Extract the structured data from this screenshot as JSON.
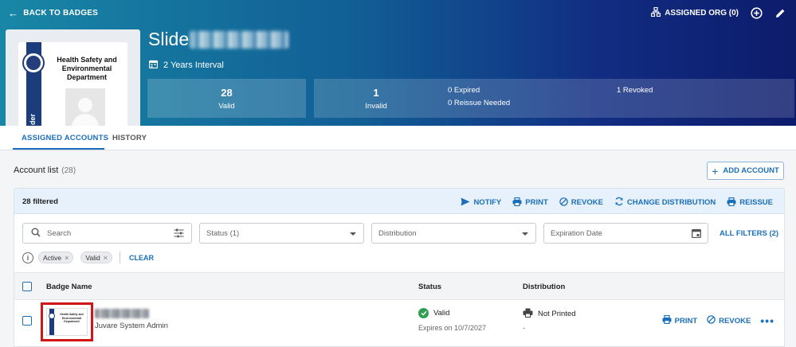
{
  "header": {
    "back_label": "BACK TO BADGES",
    "assigned_org_label": "ASSIGNED ORG (0)",
    "badge_title": "Slide",
    "interval": "2 Years Interval",
    "badge_preview": {
      "title_line": "Health Safety and Environmental Department",
      "stripe_text": "der"
    }
  },
  "stats": {
    "valid": {
      "count": "28",
      "label": "Valid"
    },
    "invalid": {
      "count": "1",
      "label": "Invalid"
    },
    "expired": "0 Expired",
    "reissue_needed": "0 Reissue Needed",
    "revoked": "1 Revoked"
  },
  "tabs": [
    {
      "label": "ASSIGNED ACCOUNTS",
      "active": true
    },
    {
      "label": "HISTORY",
      "active": false
    }
  ],
  "account_list": {
    "title": "Account list",
    "count": "(28)",
    "add_label": "ADD ACCOUNT"
  },
  "toolbar": {
    "filtered": "28 filtered",
    "actions": [
      {
        "label": "NOTIFY",
        "icon": "send-icon"
      },
      {
        "label": "PRINT",
        "icon": "printer-icon"
      },
      {
        "label": "REVOKE",
        "icon": "revoke-icon"
      },
      {
        "label": "CHANGE DISTRIBUTION",
        "icon": "sync-icon"
      },
      {
        "label": "REISSUE",
        "icon": "printer-icon"
      }
    ]
  },
  "filters": {
    "search_placeholder": "Search",
    "status": "Status (1)",
    "distribution": "Distribution",
    "expiration_date": "Expiration Date",
    "all_filters": "ALL FILTERS (2)",
    "chips": [
      "Active",
      "Valid"
    ],
    "clear": "CLEAR"
  },
  "table": {
    "columns": [
      "Badge Name",
      "Status",
      "Distribution"
    ],
    "rows": [
      {
        "role": "Juvare System Admin",
        "status": "Valid",
        "expires": "Expires on 10/7/2027",
        "distribution": "Not Printed",
        "distribution_sub": "-",
        "actions": [
          "PRINT",
          "REVOKE"
        ],
        "thumb_text": "Health Safety and Environmental Department"
      }
    ]
  },
  "colors": {
    "accent": "#1b6fb9",
    "valid_green": "#2e9e4f",
    "highlight_red": "#d21414",
    "header_start": "#1887a6",
    "header_end": "#0d1b6b"
  }
}
